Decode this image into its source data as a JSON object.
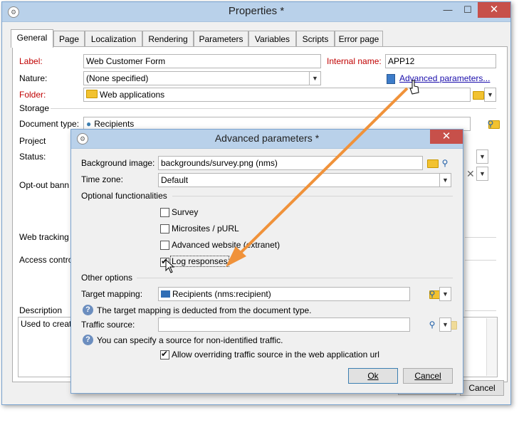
{
  "main": {
    "title": "Properties *",
    "window_controls": {
      "minimize": "—",
      "maximize": "☐",
      "close": "✕"
    },
    "tabs": [
      "General",
      "Page",
      "Localization",
      "Rendering",
      "Parameters",
      "Variables",
      "Scripts",
      "Error page"
    ],
    "active_tab": "General",
    "label": {
      "label": "Label:",
      "value": "Web Customer Form"
    },
    "internal_name": {
      "label": "Internal name:",
      "value": "APP12"
    },
    "nature": {
      "label": "Nature:",
      "value": "(None specified)"
    },
    "advanced_link": "Advanced parameters...",
    "folder": {
      "label": "Folder:",
      "value": "Web applications"
    },
    "storage_heading": "Storage",
    "document_type": {
      "label": "Document type:",
      "value": "Recipients"
    },
    "project_heading": "Project",
    "status_label": "Status:",
    "optout_label": "Opt-out bann",
    "web_tracking_label": "Web tracking",
    "access_control_label": "Access contro",
    "description_label": "Description",
    "description_value": "Used to creat",
    "cancel_button": "Cancel"
  },
  "dialog": {
    "title": "Advanced parameters *",
    "close": "✕",
    "background_image": {
      "label": "Background image:",
      "value": "backgrounds/survey.png (nms)"
    },
    "time_zone": {
      "label": "Time zone:",
      "value": "Default"
    },
    "optional_heading": "Optional functionalities",
    "options": [
      {
        "label": "Survey",
        "checked": false
      },
      {
        "label": "Microsites / pURL",
        "checked": false
      },
      {
        "label": "Advanced website (extranet)",
        "checked": false
      },
      {
        "label": "Log responses",
        "checked": true
      }
    ],
    "other_heading": "Other options",
    "target_mapping": {
      "label": "Target mapping:",
      "value": "Recipients (nms:recipient)"
    },
    "target_help": "The target mapping is deducted from the document type.",
    "traffic_source": {
      "label": "Traffic source:",
      "value": ""
    },
    "traffic_help": "You can specify a source for non-identified traffic.",
    "allow_override": {
      "label": "Allow overriding traffic source in the web application url",
      "checked": true
    },
    "ok_button": "Ok",
    "cancel_button": "Cancel"
  },
  "colors": {
    "required_label": "#c00000",
    "link": "#1a0dab",
    "arrow": "#f0923a",
    "close_button": "#c7504a"
  }
}
